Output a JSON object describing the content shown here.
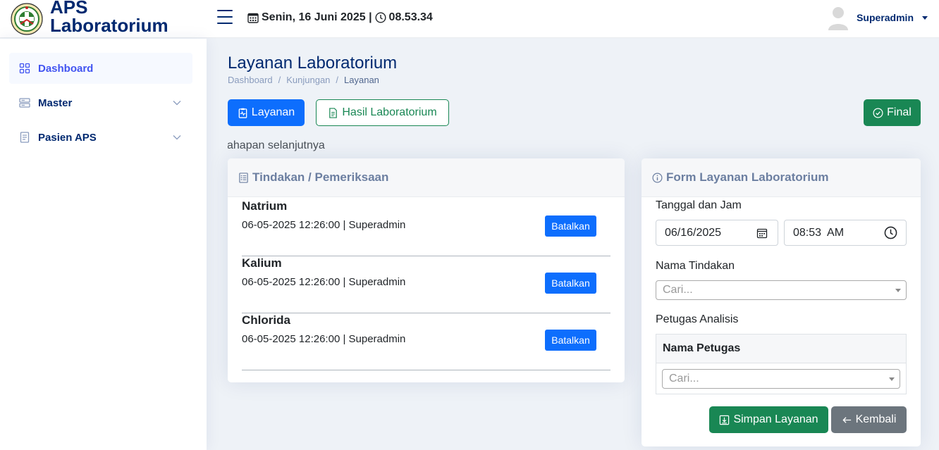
{
  "app": {
    "brand_line1": "APS",
    "brand_line2": "Laboratorium",
    "datetime": "Senin, 16 Juni 2025 | ",
    "clock": "08.53.34",
    "user_name": "Superadmin"
  },
  "sidebar": {
    "items": [
      {
        "label": "Dashboard",
        "icon": "grid-icon",
        "active": true
      },
      {
        "label": "Master",
        "icon": "server-icon",
        "active": false
      },
      {
        "label": "Pasien APS",
        "icon": "journal-icon",
        "active": false
      }
    ]
  },
  "page": {
    "title": "Layanan Laboratorium",
    "breadcrumb": [
      "Dashboard",
      "/",
      "Kunjungan",
      "/",
      "Layanan"
    ]
  },
  "toolbar": {
    "layanan_label": "Layanan",
    "hasil_label": "Hasil Laboratorium",
    "final_label": "Final"
  },
  "marquee_text": "ahapan selanjutnya",
  "tindakan": {
    "title": "Tindakan / Pemeriksaan",
    "cancel_label": "Batalkan",
    "items": [
      {
        "name": "Natrium",
        "meta": "06-05-2025 12:26:00 | Superadmin"
      },
      {
        "name": "Kalium",
        "meta": "06-05-2025 12:26:00 | Superadmin"
      },
      {
        "name": "Chlorida",
        "meta": "06-05-2025 12:26:00 | Superadmin"
      }
    ]
  },
  "form": {
    "title": "Form Layanan Laboratorium",
    "tanggal_label": "Tanggal dan Jam",
    "date_value": "06/16/2025",
    "time_value": "08:53  AM",
    "nama_tindakan_label": "Nama Tindakan",
    "nama_tindakan_placeholder": "Cari...",
    "petugas_label": "Petugas Analisis",
    "table_header": "Nama Petugas",
    "petugas_placeholder": "Cari...",
    "simpan_label": "Simpan Layanan",
    "kembali_label": "Kembali"
  },
  "colors": {
    "brand": "#012970",
    "primary": "#0d6efd",
    "success": "#198754",
    "secondary": "#6c757d"
  }
}
